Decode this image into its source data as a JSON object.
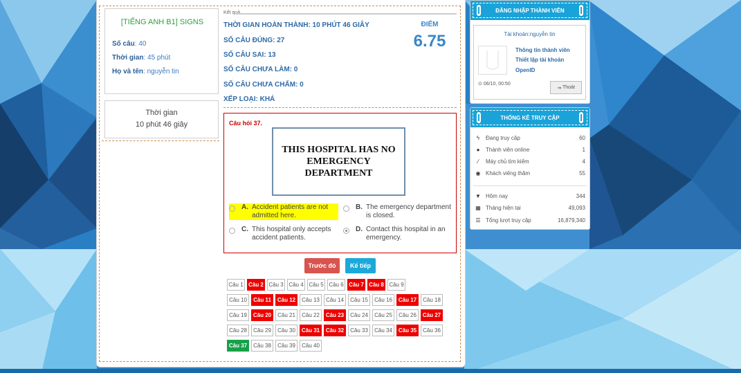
{
  "exam": {
    "title": "[TIẾNG ANH B1] SIGNS",
    "num_questions_label": "Số câu",
    "num_questions_value": ": 40",
    "time_label": "Thời gian",
    "time_value": ": 45 phút",
    "name_label": "Họ và tên",
    "name_value": ": nguyễn tin"
  },
  "timer": {
    "label": "Thời gian",
    "value": "10 phút 46 giây"
  },
  "result": {
    "section_label": "Kết quả",
    "completion_time": "THỜI GIAN HOÀN THÀNH: 10 PHÚT 46 GIÂY",
    "correct": "SỐ CÂU ĐÚNG: 27",
    "wrong": "SỐ CÂU SAI: 13",
    "unanswered": "SỐ CÂU CHƯA LÀM: 0",
    "ungraded": "SỐ CÂU CHƯA CHẤM: 0",
    "rank": "XẾP LOẠI: KHÁ",
    "score_label": "ĐIỂM",
    "score_value": "6.75"
  },
  "question": {
    "title": "Câu hỏi 37.",
    "sign_text": "THIS HOSPITAL HAS NO EMERGENCY DEPARTMENT",
    "options": [
      {
        "letter": "A.",
        "text": "Accident patients are not admitted here.",
        "highlighted": true,
        "selected": false
      },
      {
        "letter": "B.",
        "text": "The emergency department is closed.",
        "highlighted": false,
        "selected": false
      },
      {
        "letter": "C.",
        "text": "This hospital only accepts accident patients.",
        "highlighted": false,
        "selected": false
      },
      {
        "letter": "D.",
        "text": "Contact this hospital in an emergency.",
        "highlighted": false,
        "selected": true
      }
    ]
  },
  "nav": {
    "prev_label": "Trước đó",
    "next_label": "Kế tiếp",
    "prev_color": "#d9534f",
    "next_color": "#1ba9d9"
  },
  "question_grid": [
    {
      "label": "Câu 1",
      "status": "normal"
    },
    {
      "label": "Câu 2",
      "status": "wrong"
    },
    {
      "label": "Câu 3",
      "status": "normal"
    },
    {
      "label": "Câu 4",
      "status": "normal"
    },
    {
      "label": "Câu 5",
      "status": "normal"
    },
    {
      "label": "Câu 6",
      "status": "normal"
    },
    {
      "label": "Câu 7",
      "status": "wrong"
    },
    {
      "label": "Câu 8",
      "status": "wrong"
    },
    {
      "label": "Câu 9",
      "status": "normal"
    },
    {
      "label": "Câu 10",
      "status": "normal"
    },
    {
      "label": "Câu 11",
      "status": "wrong"
    },
    {
      "label": "Câu 12",
      "status": "wrong"
    },
    {
      "label": "Câu 13",
      "status": "normal"
    },
    {
      "label": "Câu 14",
      "status": "normal"
    },
    {
      "label": "Câu 15",
      "status": "normal"
    },
    {
      "label": "Câu 16",
      "status": "normal"
    },
    {
      "label": "Câu 17",
      "status": "wrong"
    },
    {
      "label": "Câu 18",
      "status": "normal"
    },
    {
      "label": "Câu 19",
      "status": "normal"
    },
    {
      "label": "Câu 20",
      "status": "wrong"
    },
    {
      "label": "Câu 21",
      "status": "normal"
    },
    {
      "label": "Câu 22",
      "status": "normal"
    },
    {
      "label": "Câu 23",
      "status": "wrong"
    },
    {
      "label": "Câu 24",
      "status": "normal"
    },
    {
      "label": "Câu 25",
      "status": "normal"
    },
    {
      "label": "Câu 26",
      "status": "normal"
    },
    {
      "label": "Câu 27",
      "status": "wrong"
    },
    {
      "label": "Câu 28",
      "status": "normal"
    },
    {
      "label": "Câu 29",
      "status": "normal"
    },
    {
      "label": "Câu 30",
      "status": "normal"
    },
    {
      "label": "Câu 31",
      "status": "wrong"
    },
    {
      "label": "Câu 32",
      "status": "wrong"
    },
    {
      "label": "Câu 33",
      "status": "normal"
    },
    {
      "label": "Câu 34",
      "status": "normal"
    },
    {
      "label": "Câu 35",
      "status": "wrong"
    },
    {
      "label": "Câu 36",
      "status": "normal"
    },
    {
      "label": "Câu 37",
      "status": "current"
    },
    {
      "label": "Câu 38",
      "status": "normal"
    },
    {
      "label": "Câu 39",
      "status": "normal"
    },
    {
      "label": "Câu 40",
      "status": "normal"
    }
  ],
  "login_panel": {
    "header": "ĐĂNG NHẬP THÀNH VIÊN",
    "account": "Tài khoản:nguyễn tin",
    "links": [
      "Thông tin thành viên",
      "Thiết lập tài khoản",
      "OpenID"
    ],
    "time": "06/10, 00:50",
    "logout_label": "Thoát",
    "avatar_icon": "avatar-placeholder-icon",
    "clock_icon": "clock-icon",
    "logout_icon": "sign-out-icon"
  },
  "stats_panel": {
    "header": "THỐNG KÊ TRUY CẬP",
    "online": [
      {
        "icon": "bolt-icon",
        "label": "Đang truy cập",
        "value": "60"
      },
      {
        "icon": "user-icon",
        "label": "Thành viên online",
        "value": "1"
      },
      {
        "icon": "magic-icon",
        "label": "Máy chủ tìm kiếm",
        "value": "4"
      },
      {
        "icon": "eye-icon",
        "label": "Khách viếng thăm",
        "value": "55"
      }
    ],
    "totals": [
      {
        "icon": "filter-icon",
        "label": "Hôm nay",
        "value": "344"
      },
      {
        "icon": "calendar-icon",
        "label": "Tháng hiện tại",
        "value": "49,093"
      },
      {
        "icon": "bars-icon",
        "label": "Tổng lượt truy cập",
        "value": "16,879,340"
      }
    ]
  },
  "colors": {
    "accent_blue": "#1aa3d8",
    "text_blue": "#2d6aa6",
    "wrong_red": "#ee0000",
    "current_green": "#18a049",
    "title_green": "#2ea043"
  }
}
